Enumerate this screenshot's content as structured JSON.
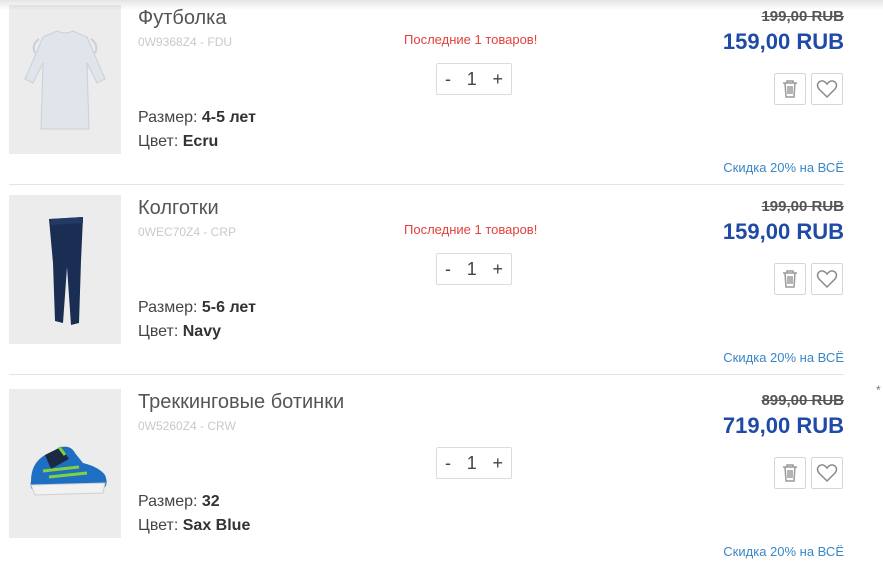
{
  "items": [
    {
      "name": "Футболка",
      "sku": "0W9368Z4 - FDU",
      "stock_notice": "Последние 1 товаров!",
      "qty": {
        "minus": "-",
        "value": "1",
        "plus": "+"
      },
      "size_label": "Размер:",
      "size_value": "4-5 лет",
      "color_label": "Цвет:",
      "color_value": "Ecru",
      "old_price": "199,00 RUB",
      "new_price": "159,00 RUB",
      "promo": "Скидка 20% на ВСЁ",
      "image": "white-long-sleeve-top"
    },
    {
      "name": "Колготки",
      "sku": "0WEC70Z4 - CRP",
      "stock_notice": "Последние 1 товаров!",
      "qty": {
        "minus": "-",
        "value": "1",
        "plus": "+"
      },
      "size_label": "Размер:",
      "size_value": "5-6 лет",
      "color_label": "Цвет:",
      "color_value": "Navy",
      "old_price": "199,00 RUB",
      "new_price": "159,00 RUB",
      "promo": "Скидка 20% на ВСЁ",
      "image": "navy-tights"
    },
    {
      "name": "Треккинговые ботинки",
      "sku": "0W5260Z4 - CRW",
      "stock_notice": "",
      "qty": {
        "minus": "-",
        "value": "1",
        "plus": "+"
      },
      "size_label": "Размер:",
      "size_value": "32",
      "color_label": "Цвет:",
      "color_value": "Sax Blue",
      "old_price": "899,00 RUB",
      "new_price": "719,00 RUB",
      "promo": "Скидка 20% на ВСЁ",
      "image": "blue-trekking-boots"
    }
  ],
  "side_mark": "*",
  "colors": {
    "price_accent": "#1f4aa8",
    "stock_warning": "#e2423d",
    "promo_link": "#3a86c8"
  },
  "icons": {
    "delete": "trash-icon",
    "favorite": "heart-icon"
  }
}
